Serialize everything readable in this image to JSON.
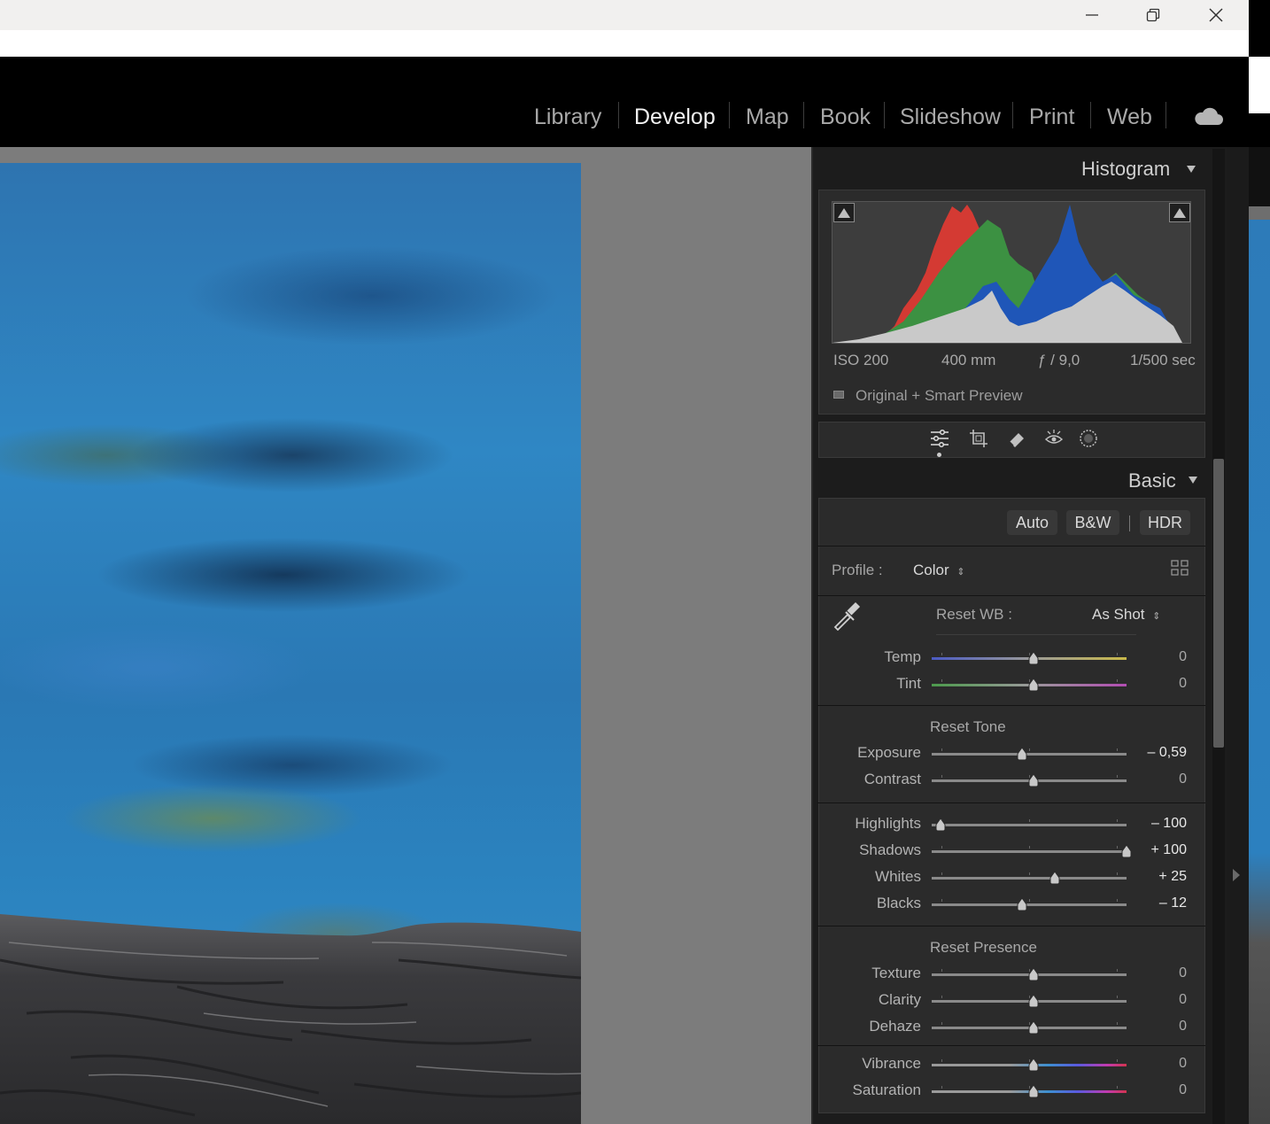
{
  "modules": [
    "Library",
    "Develop",
    "Map",
    "Book",
    "Slideshow",
    "Print",
    "Web"
  ],
  "active_module": "Develop",
  "histogram": {
    "title": "Histogram",
    "iso": "ISO 200",
    "focal": "400 mm",
    "aperture": "ƒ / 9,0",
    "shutter": "1/500 sec",
    "preview_status": "Original + Smart Preview"
  },
  "basic": {
    "title": "Basic",
    "auto_label": "Auto",
    "bw_label": "B&W",
    "hdr_label": "HDR",
    "profile_label": "Profile :",
    "profile_value": "Color",
    "wb_label": "Reset WB :",
    "wb_value": "As Shot",
    "tone_title": "Reset Tone",
    "presence_title": "Reset Presence",
    "sliders": {
      "temp": {
        "label": "Temp",
        "value": "0",
        "position": 0.5
      },
      "tint": {
        "label": "Tint",
        "value": "0",
        "position": 0.5
      },
      "exposure": {
        "label": "Exposure",
        "value": "– 0,59",
        "position": 0.44
      },
      "contrast": {
        "label": "Contrast",
        "value": "0",
        "position": 0.5
      },
      "highlights": {
        "label": "Highlights",
        "value": "– 100",
        "position": 0.0
      },
      "shadows": {
        "label": "Shadows",
        "value": "+ 100",
        "position": 1.0
      },
      "whites": {
        "label": "Whites",
        "value": "+ 25",
        "position": 0.615
      },
      "blacks": {
        "label": "Blacks",
        "value": "– 12",
        "position": 0.44
      },
      "texture": {
        "label": "Texture",
        "value": "0",
        "position": 0.5
      },
      "clarity": {
        "label": "Clarity",
        "value": "0",
        "position": 0.5
      },
      "dehaze": {
        "label": "Dehaze",
        "value": "0",
        "position": 0.5
      },
      "vibrance": {
        "label": "Vibrance",
        "value": "0",
        "position": 0.5
      },
      "saturation": {
        "label": "Saturation",
        "value": "0",
        "position": 0.5
      }
    }
  },
  "colors": {
    "panel_bg": "#1c1c1c",
    "section_bg": "#2b2b2b",
    "canvas_bg": "#7c7c7c",
    "hist_red": "#d43a33",
    "hist_green": "#3c9142",
    "hist_blue": "#1f56b8",
    "hist_gray": "#c9c9c9"
  },
  "icons": [
    "minimize-icon",
    "restore-icon",
    "close-icon",
    "cloud-icon",
    "sliders-icon",
    "crop-icon",
    "heal-icon",
    "redeye-icon",
    "mask-icon",
    "eyedropper-icon",
    "grid-icon"
  ]
}
